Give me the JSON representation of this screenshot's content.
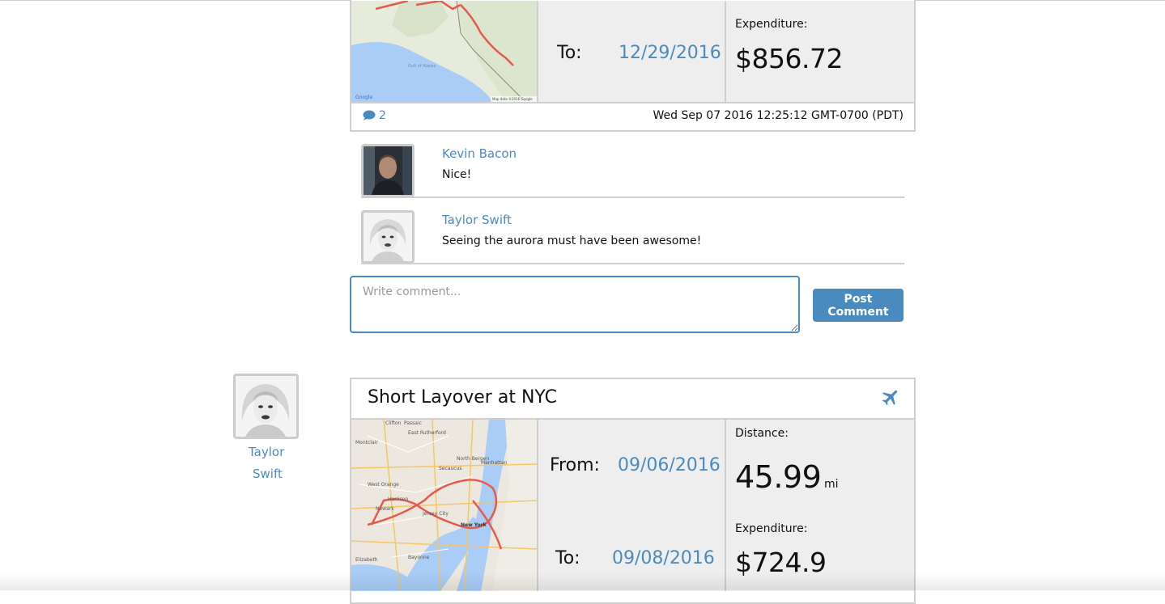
{
  "trip1": {
    "to_label": "To:",
    "to_date": "12/29/2016",
    "expenditure_label": "Expenditure:",
    "expenditure_value": "$856.72",
    "comment_count": "2",
    "timestamp": "Wed Sep 07 2016 12:25:12 GMT-0700 (PDT)",
    "map_attribution": "Map data ©2016 Google",
    "map_place": "Gulf of Alaska"
  },
  "comments": [
    {
      "author": "Kevin Bacon",
      "text": "Nice!"
    },
    {
      "author": "Taylor Swift",
      "text": "Seeing the aurora must have been awesome!"
    }
  ],
  "comment_form": {
    "placeholder": "Write comment...",
    "submit_label": "Post Comment"
  },
  "trip2": {
    "author_first": "Taylor",
    "author_last": "Swift",
    "title": "Short Layover at NYC",
    "icon": "airplane-icon",
    "from_label": "From:",
    "from_date": "09/06/2016",
    "to_label": "To:",
    "to_date": "09/08/2016",
    "distance_label": "Distance:",
    "distance_value": "45.99",
    "distance_unit": "mi",
    "expenditure_label": "Expenditure:",
    "expenditure_value": "$724.9",
    "map_places": [
      "Clifton",
      "Passaic",
      "East Rutherford",
      "North Bergen",
      "Manhattan",
      "Montclair",
      "Secaucus",
      "West Orange",
      "Harrison",
      "Newark",
      "Jersey City",
      "New York",
      "Elizabeth",
      "Bayonne"
    ]
  },
  "colors": {
    "accent": "#4a8bbf",
    "border": "#cfcfcf",
    "panel": "#eeeeee"
  }
}
